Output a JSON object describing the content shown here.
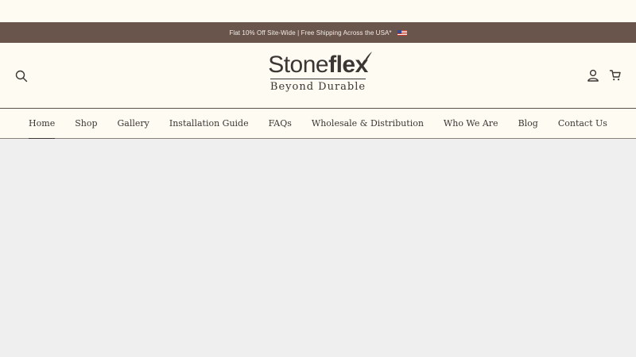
{
  "announcement": {
    "text": "Flat 10% Off Site-Wide | Free Shipping Across the USA*",
    "flag_icon": "us-flag-icon"
  },
  "header": {
    "search_icon": "search-icon",
    "logo": {
      "word_regular": "Stone",
      "word_bold": "flex",
      "tagline": "Beyond Durable"
    },
    "account_icon": "account-icon",
    "cart_icon": "cart-icon"
  },
  "nav": {
    "items": [
      {
        "label": "Home",
        "active": true
      },
      {
        "label": "Shop"
      },
      {
        "label": "Gallery"
      },
      {
        "label": "Installation Guide"
      },
      {
        "label": "FAQs"
      },
      {
        "label": "Wholesale & Distribution"
      },
      {
        "label": "Who We Are"
      },
      {
        "label": "Blog"
      },
      {
        "label": "Contact Us"
      }
    ]
  },
  "colors": {
    "announcement_bg": "#6a554d",
    "page_bg": "#fefcf2",
    "text": "#3b3533",
    "main_bg": "#efefef"
  }
}
